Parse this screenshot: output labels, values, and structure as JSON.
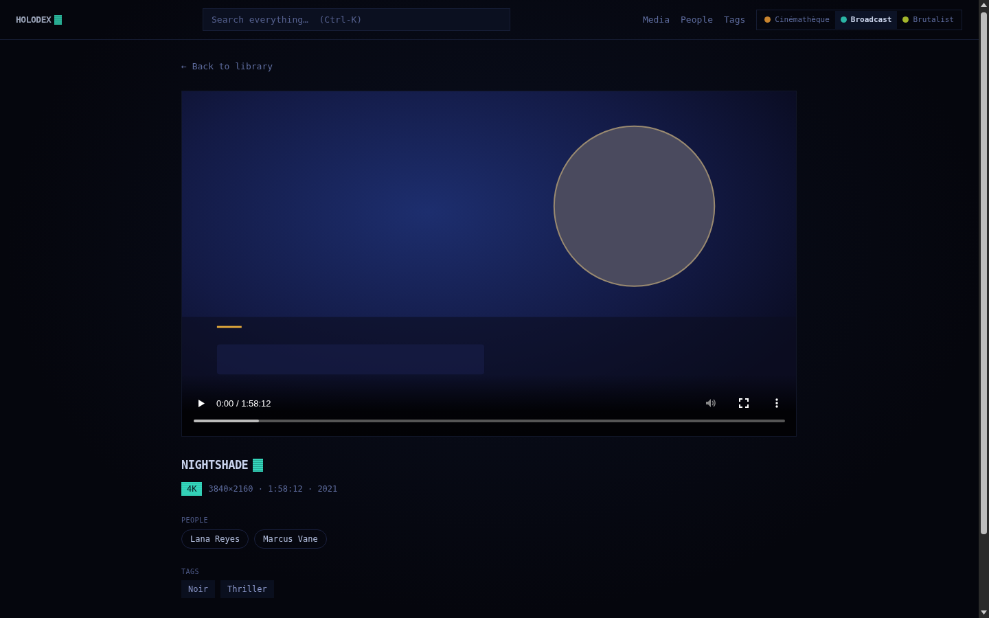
{
  "header": {
    "logo": "HOLODEX",
    "search": {
      "placeholder": "Search everything…  (Ctrl-K)"
    },
    "nav": [
      {
        "label": "Media"
      },
      {
        "label": "People"
      },
      {
        "label": "Tags"
      }
    ],
    "themes": [
      {
        "label": "Cinémathèque",
        "color": "#c8842e",
        "selected": false
      },
      {
        "label": "Broadcast",
        "color": "#2bb5a5",
        "selected": true
      },
      {
        "label": "Brutalist",
        "color": "#a3b52b",
        "selected": false
      }
    ]
  },
  "back_link": "← Back to library",
  "player": {
    "time": "0:00 / 1:58:12",
    "buffer": {
      "level": 0.11
    }
  },
  "media": {
    "title": "NIGHTSHADE",
    "badge": "4K",
    "meta": "3840×2160 · 1:58:12 · 2021",
    "people_label": "PEOPLE",
    "people": [
      "Lana Reyes",
      "Marcus Vane"
    ],
    "tags_label": "TAGS",
    "tags": [
      "Noir",
      "Thriller"
    ]
  }
}
